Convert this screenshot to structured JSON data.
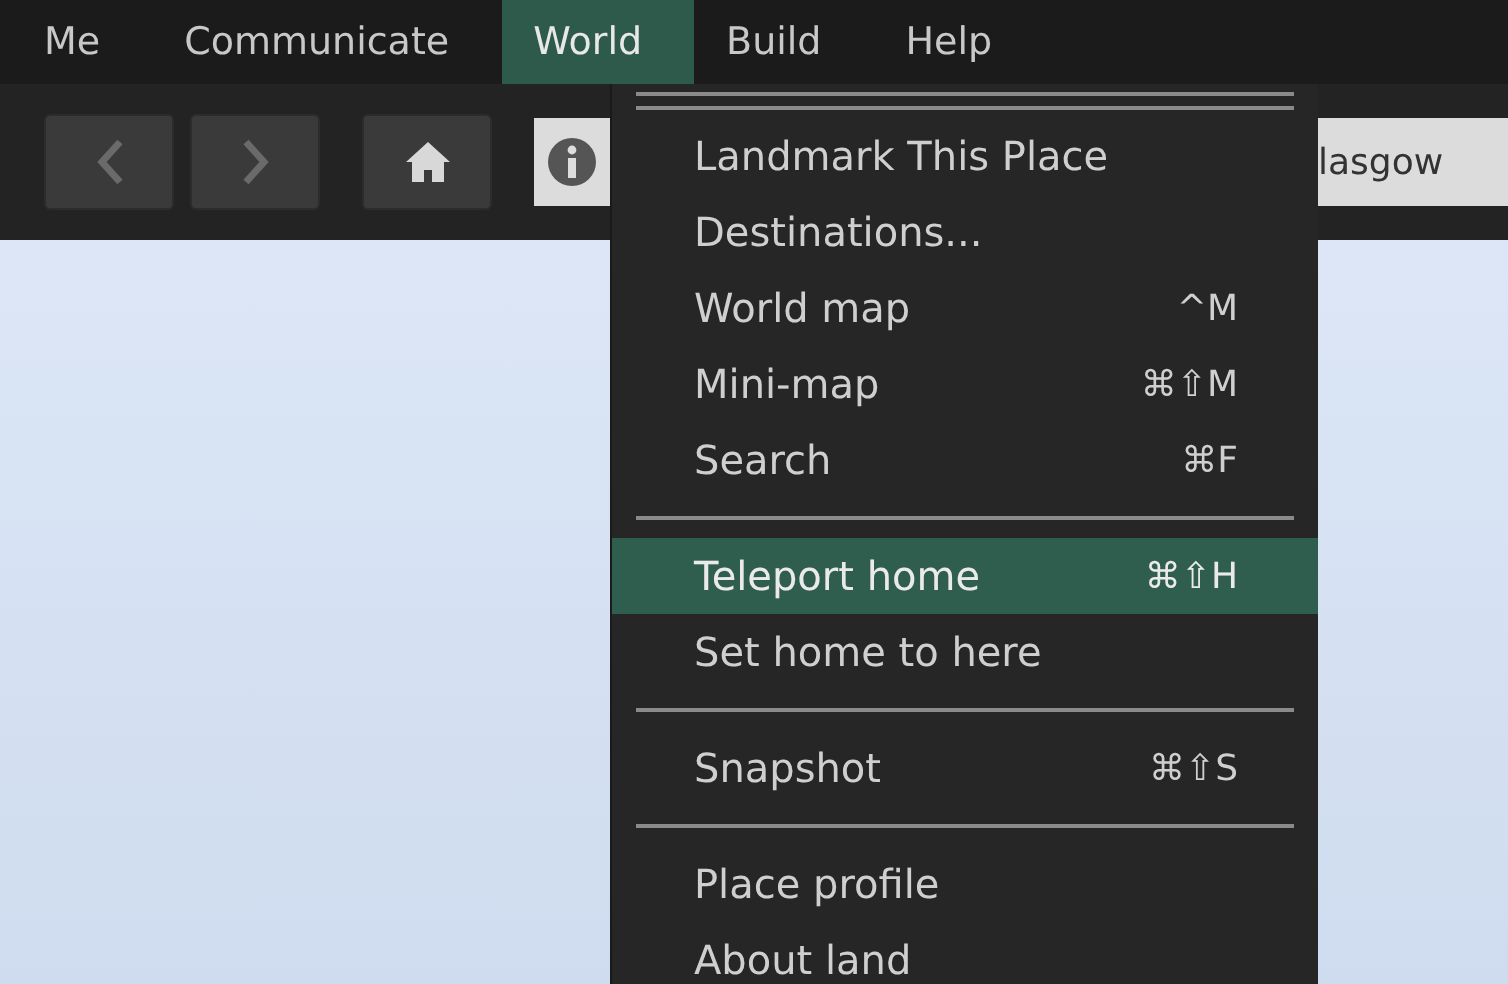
{
  "menu_bar": [
    {
      "label": "Me",
      "selected": false
    },
    {
      "label": "Communicate",
      "selected": false
    },
    {
      "label": "World",
      "selected": true
    },
    {
      "label": "Build",
      "selected": false
    },
    {
      "label": "Help",
      "selected": false
    }
  ],
  "toolbar": {
    "location": "lasgow"
  },
  "world_menu": [
    {
      "kind": "double"
    },
    {
      "kind": "item",
      "label": "Landmark This Place",
      "selected": false
    },
    {
      "kind": "item",
      "label": "Destinations...",
      "selected": false
    },
    {
      "kind": "item",
      "label": "World map",
      "shortcut": "^M",
      "selected": false
    },
    {
      "kind": "item",
      "label": "Mini-map",
      "shortcut": "⌘⇧M",
      "selected": false
    },
    {
      "kind": "item",
      "label": "Search",
      "shortcut": "⌘F",
      "selected": false
    },
    {
      "kind": "separator"
    },
    {
      "kind": "item",
      "label": "Teleport home",
      "shortcut": "⌘⇧H",
      "selected": true
    },
    {
      "kind": "item",
      "label": "Set home to here",
      "selected": false
    },
    {
      "kind": "separator"
    },
    {
      "kind": "item",
      "label": "Snapshot",
      "shortcut": "⌘⇧S",
      "selected": false
    },
    {
      "kind": "separator"
    },
    {
      "kind": "item",
      "label": "Place profile",
      "selected": false
    },
    {
      "kind": "item",
      "label": "About land",
      "selected": false
    }
  ]
}
